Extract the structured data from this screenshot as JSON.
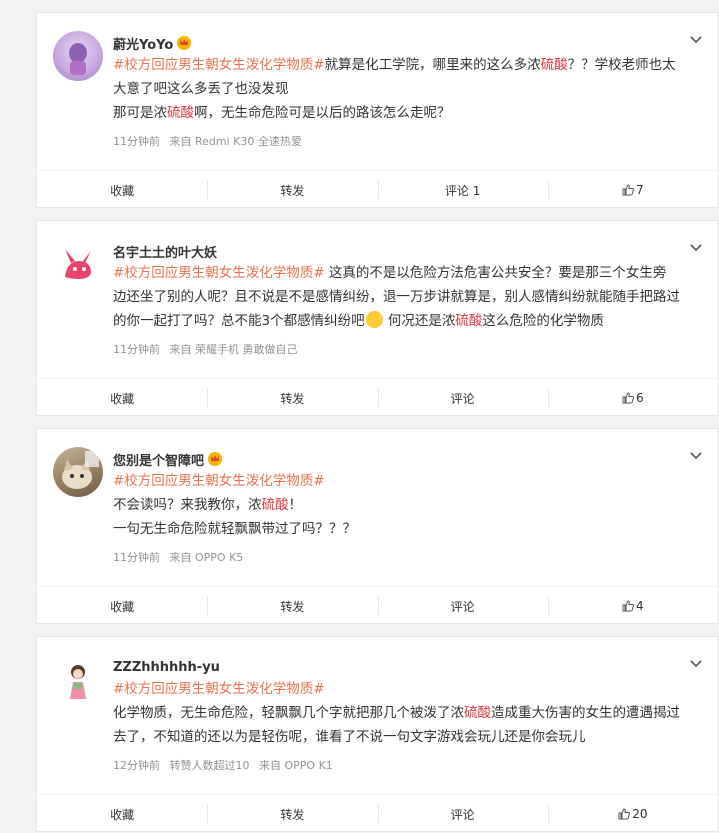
{
  "comments": [
    {
      "username": "蔚光YoYo",
      "tag": "#校方回应男生朝女生泼化学物质#",
      "line1_rest": "就算是化工学院，哪里来的这么多浓",
      "hl1": "硫酸",
      "line1_end": "？？学校老师也太",
      "line2": "大意了吧这么多丢了也没发现",
      "line3_a": "那可是浓",
      "hl2": "硫酸",
      "line3_b": "啊，无生命危险可是以后的路该怎么走呢？",
      "time": "11分钟前",
      "source": "来自 Redmi K30 全速热爱",
      "collect": "收藏",
      "repost": "转发",
      "comment": "评论 1",
      "likes": "7"
    },
    {
      "username": "名宇土土的叶大妖",
      "tag": "#校方回应男生朝女生泼化学物质#",
      "line1_rest": " 这真的不是以危险方法危害公共安全？要是那三个女生旁",
      "line2": "边还坐了别的人呢？且不说是不是感情纠纷，退一万步讲就算是，别人感情纠纷就能随手把路过",
      "line3_a": "的你一起打了吗？总不能3个都感情纠纷吧",
      "line3_b": " 何况还是浓",
      "hl": "硫酸",
      "line3_c": "这么危险的化学物质",
      "time": "11分钟前",
      "source": "来自 荣耀手机 勇敢做自己",
      "collect": "收藏",
      "repost": "转发",
      "comment": "评论",
      "likes": "6"
    },
    {
      "username": "您别是个智障吧",
      "tag": "#校方回应男生朝女生泼化学物质#",
      "line1_a": "不会读吗？来我教你，浓",
      "hl": "硫酸",
      "line1_b": "！",
      "line2": "一句无生命危险就轻飘飘带过了吗？？？",
      "time": "11分钟前",
      "source": "来自 OPPO K5",
      "collect": "收藏",
      "repost": "转发",
      "comment": "评论",
      "likes": "4"
    },
    {
      "username": "ZZZhhhhhh-yu",
      "tag": "#校方回应男生朝女生泼化学物质#",
      "line1_a": "化学物质，无生命危险，轻飘飘几个字就把那几个被泼了浓",
      "hl": "硫酸",
      "line1_b": "造成重大伤害的女生的遭遇揭过",
      "line2": "去了，不知道的还以为是轻伤呢，谁看了不说一句文字游戏会玩儿还是你会玩儿",
      "time": "12分钟前",
      "extra": "转赞人数超过10",
      "source": "来自 OPPO K1",
      "collect": "收藏",
      "repost": "转发",
      "comment": "评论",
      "likes": "20"
    }
  ],
  "colors": {
    "tag": "#eb7350",
    "highlight": "#e0383e",
    "meta": "#939393"
  },
  "icons": {
    "expand": "chevron-down-icon",
    "like": "thumbs-up-icon",
    "vip": "crown-badge-icon"
  }
}
